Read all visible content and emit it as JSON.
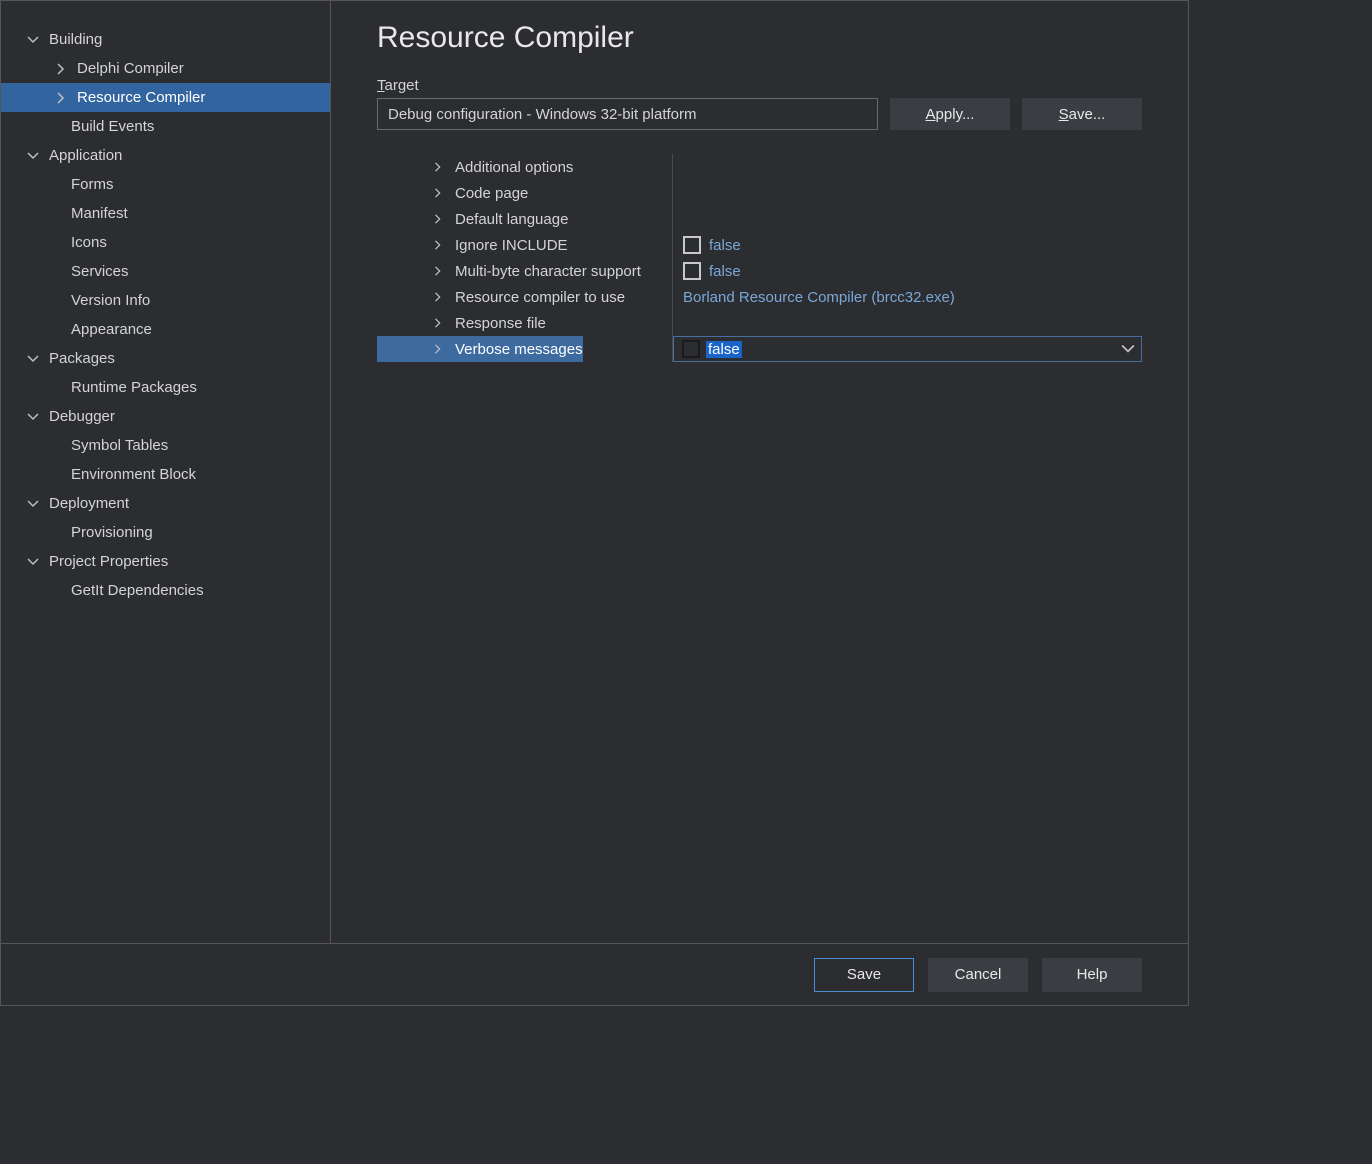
{
  "page": {
    "title": "Resource Compiler",
    "target_label_prefix": "T",
    "target_label_rest": "arget"
  },
  "sidebar": {
    "groups": [
      {
        "label": "Building",
        "children": [
          {
            "label": "Delphi Compiler",
            "expandable": true
          },
          {
            "label": "Resource Compiler",
            "expandable": true,
            "selected": true
          },
          {
            "label": "Build Events",
            "expandable": false
          }
        ]
      },
      {
        "label": "Application",
        "children": [
          {
            "label": "Forms"
          },
          {
            "label": "Manifest"
          },
          {
            "label": "Icons"
          },
          {
            "label": "Services"
          },
          {
            "label": "Version Info"
          },
          {
            "label": "Appearance"
          }
        ]
      },
      {
        "label": "Packages",
        "children": [
          {
            "label": "Runtime Packages"
          }
        ]
      },
      {
        "label": "Debugger",
        "children": [
          {
            "label": "Symbol Tables"
          },
          {
            "label": "Environment Block"
          }
        ]
      },
      {
        "label": "Deployment",
        "children": [
          {
            "label": "Provisioning"
          }
        ]
      },
      {
        "label": "Project Properties",
        "children": [
          {
            "label": "GetIt Dependencies"
          }
        ]
      }
    ]
  },
  "target": {
    "value": "Debug configuration - Windows 32-bit platform",
    "apply_prefix": "A",
    "apply_rest": "pply...",
    "save_prefix": "S",
    "save_rest": "ave..."
  },
  "options": [
    {
      "label": "Additional options",
      "value": null
    },
    {
      "label": "Code page",
      "value": null
    },
    {
      "label": "Default language",
      "value": null
    },
    {
      "label": "Ignore INCLUDE",
      "value": "false",
      "checkbox": true
    },
    {
      "label": "Multi-byte character support",
      "value": "false",
      "checkbox": true
    },
    {
      "label": "Resource compiler to use",
      "value": "Borland Resource Compiler (brcc32.exe)"
    },
    {
      "label": "Response file",
      "value": null
    },
    {
      "label": "Verbose messages",
      "value": "false",
      "checkbox": true,
      "selected": true
    }
  ],
  "footer": {
    "save": "Save",
    "cancel": "Cancel",
    "help": "Help"
  }
}
